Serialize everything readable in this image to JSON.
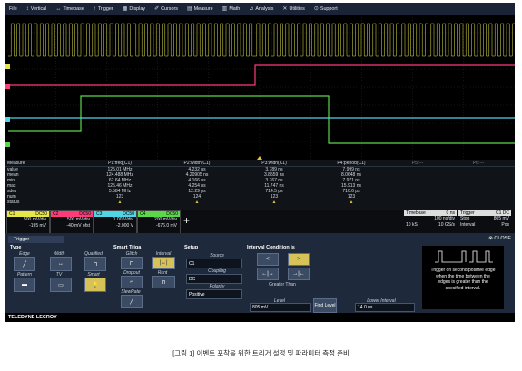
{
  "menu": [
    "File",
    "Vertical",
    "Timebase",
    "Trigger",
    "Display",
    "Cursors",
    "Measure",
    "Math",
    "Analysis",
    "Utilities",
    "Support"
  ],
  "menu_icons": [
    "",
    "vertical-arrows-icon",
    "horizontal-arrows-icon",
    "trigger-icon",
    "display-icon",
    "cursor-icon",
    "measure-icon",
    "math-icon",
    "analysis-icon",
    "utilities-icon",
    "support-icon"
  ],
  "colors": {
    "c1": "#e6e64a",
    "c2": "#ff3b7a",
    "c3": "#4fd4e8",
    "c4": "#5bd84a",
    "menu": "#1a2436",
    "dialog": "#1e2a3c"
  },
  "measure": {
    "headers": [
      "Measure",
      "P1:freq(C1)",
      "P2:width(C1)",
      "P3:widn(C1)",
      "P4:period(C1)",
      "P5:---",
      "P6:---"
    ],
    "rows": [
      [
        "value",
        "125.01 MHz",
        "4.232 ns",
        "3.789 ns",
        "7.999 ns",
        "",
        ""
      ],
      [
        "mean",
        "124.488 MHz",
        "4.20905 ns",
        "3.8559 ns",
        "8.0648 ns",
        "",
        ""
      ],
      [
        "min",
        "62.64 MHz",
        "4.166 ns",
        "3.767 ns",
        "7.971 ns",
        "",
        ""
      ],
      [
        "max",
        "125.46 MHz",
        "4.254 ns",
        "11.747 ns",
        "15.913 ns",
        "",
        ""
      ],
      [
        "sdev",
        "5.584 MHz",
        "12.29 ps",
        "714.5 ps",
        "710.6 ps",
        "",
        ""
      ],
      [
        "num",
        "123",
        "124",
        "123",
        "123",
        "",
        ""
      ],
      [
        "status",
        "▲",
        "▲",
        "▲",
        "▲",
        "",
        ""
      ]
    ]
  },
  "channels": [
    {
      "name": "C1",
      "coupling": "DC50",
      "vdiv": "500 mV/div",
      "offset": "-195 mV"
    },
    {
      "name": "C2",
      "coupling": "DC50",
      "vdiv": "500 mV/div",
      "offset": "-40 mV ofst"
    },
    {
      "name": "C3",
      "coupling": "DC50",
      "vdiv": "1.00 V/div",
      "offset": "-2.000 V"
    },
    {
      "name": "C4",
      "coupling": "DC50",
      "vdiv": "200 mV/div",
      "offset": "-676.0 mV"
    }
  ],
  "add_channel": "+",
  "timebase": {
    "label": "Timebase",
    "value": "0 ns",
    "row1": "100 ns/div",
    "row2a": "10 kS",
    "row2b": "10 GS/s"
  },
  "trigger_info": {
    "label": "Trigger",
    "coupling": "C1 DC",
    "row1a": "Stop",
    "row1b": "805 mV",
    "row2a": "Interval",
    "row2b": "Pos"
  },
  "trigger": {
    "tab": "Trigger",
    "close": "CLOSE",
    "type_section": "Type",
    "types": [
      "Edge",
      "Width",
      "Qualified",
      "Pattern",
      "TV",
      "Smart"
    ],
    "smart_section": "Smart Triga",
    "smart_types": [
      "Glitch",
      "Interval",
      "Dropout",
      "Runt",
      "SlewRate"
    ],
    "setup_section": "Setup",
    "source_label": "Source",
    "source": "C1",
    "coupling_label": "Coupling",
    "coupling": "DC",
    "polarity_label": "Polarity",
    "polarity": "Positive",
    "condition_section": "Interval Condition is",
    "cond_buttons": [
      "<",
      ">",
      "←|→",
      "→|←"
    ],
    "cond_value": "Greater Than",
    "level_label": "Level",
    "level": "805 mV",
    "find_level": "Find Level",
    "lower_label": "Lower Interval",
    "lower": "14.0 ns",
    "info": "Trigger on second positive edge when the time between the edges is greater than the specified interval."
  },
  "brand": "TELEDYNE LECROY",
  "caption": "[그림 1] 이벤트 포착을 위한 트리거 설정 및 파라미터 측정 준비"
}
